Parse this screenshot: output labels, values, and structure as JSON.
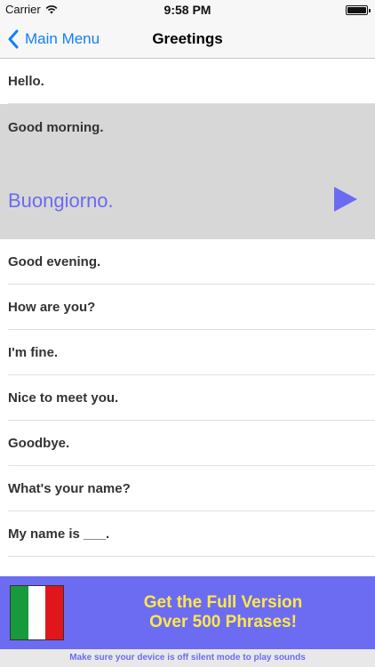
{
  "status_bar": {
    "carrier": "Carrier",
    "time": "9:58 PM",
    "wifi_icon": "wifi-icon",
    "battery_icon": "battery-icon"
  },
  "nav": {
    "back_label": "Main Menu",
    "title": "Greetings",
    "back_icon": "chevron-left-icon",
    "accent_color": "#147efb"
  },
  "phrases": {
    "items": [
      {
        "label": "Hello."
      },
      {
        "label": "Good morning.",
        "translation": "Buongiorno.",
        "expanded": true
      },
      {
        "label": "Good evening."
      },
      {
        "label": "How are you?"
      },
      {
        "label": "I'm fine."
      },
      {
        "label": "Nice to meet you."
      },
      {
        "label": "Goodbye."
      },
      {
        "label": "What's your name?"
      },
      {
        "label": "My name is ___."
      }
    ],
    "play_icon": "play-icon",
    "expanded_bg": "#d7d7d7",
    "translation_color": "#6b6bf2"
  },
  "banner": {
    "line1": "Get the Full Version",
    "line2": "Over 500 Phrases!",
    "flag_icon": "italian-flag-icon",
    "bg_color": "#6c6cf2",
    "text_color": "#ffe84a"
  },
  "footer": {
    "text": "Make sure your device is off silent mode to play sounds"
  }
}
